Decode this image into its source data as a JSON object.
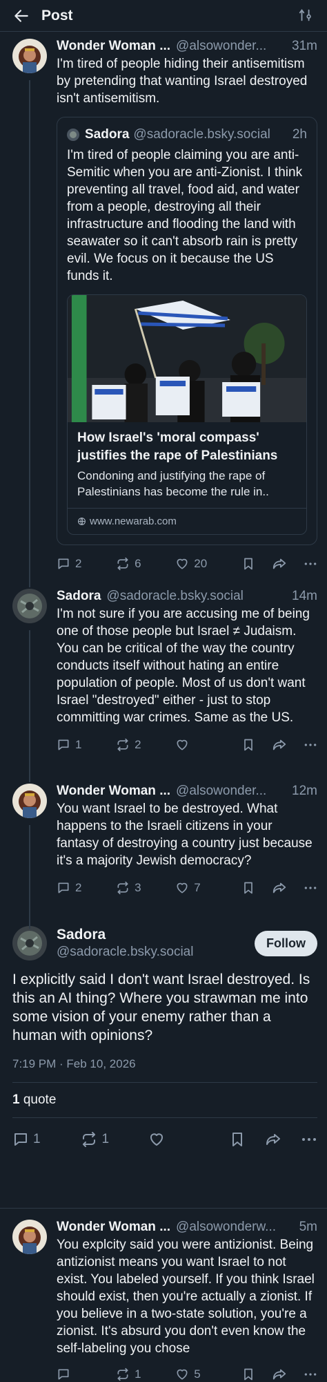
{
  "header": {
    "title": "Post"
  },
  "posts": [
    {
      "name": "Wonder Woman ...",
      "handle": "@alsowonder...",
      "time": "31m",
      "text": "I'm tired of people hiding their antisemitism by pretending that wanting Israel destroyed isn't antisemitism.",
      "quote": {
        "name": "Sadora",
        "handle": "@sadoracle.bsky.social",
        "time": "2h",
        "text": "I'm tired of people claiming you are anti-Semitic when you are anti-Zionist. I think preventing all travel, food aid, and water from a people, destroying all their infrastructure and flooding the land with seawater so it can't absorb rain is pretty evil. We focus on it because the US funds it.",
        "card": {
          "title": "How Israel's 'moral compass' justifies the rape of Palestinians",
          "description": "Condoning and justifying the rape of Palestinians has become the rule in..",
          "domain": "www.newarab.com"
        }
      },
      "replies": "2",
      "reposts": "6",
      "likes": "20"
    },
    {
      "name": "Sadora",
      "handle": "@sadoracle.bsky.social",
      "time": "14m",
      "text": "I'm not sure if you are accusing me of being one of those people but Israel ≠ Judaism. You can be critical of the way the country conducts itself without hating an entire population of people. Most of us don't want Israel \"destroyed\" either - just to stop committing war crimes. Same as the US.",
      "replies": "1",
      "reposts": "2",
      "likes": ""
    },
    {
      "name": "Wonder Woman ...",
      "handle": "@alsowonder...",
      "time": "12m",
      "text": "You want Israel to be destroyed. What happens to the Israeli citizens in your fantasy of destroying a country just because it's a majority Jewish democracy?",
      "replies": "2",
      "reposts": "3",
      "likes": "7"
    }
  ],
  "focus": {
    "name": "Sadora",
    "handle": "@sadoracle.bsky.social",
    "follow_label": "Follow",
    "text": "I explicitly said I don't want Israel destroyed. Is this an AI thing? Where you strawman me into some vision of your enemy rather than a human with opinions?",
    "date": "7:19 PM · Feb 10, 2026",
    "quote_count": "1",
    "quote_label": "quote",
    "replies": "1",
    "reposts": "1"
  },
  "last_post": {
    "name": "Wonder Woman ...",
    "handle": "@alsowonderw...",
    "time": "5m",
    "text": "You explcity said you were antizionist. Being antizionist means you want Israel to not exist. You labeled yourself. If you think Israel should exist, then you're actually a zionist. If you believe in a two-state solution, you're a zionist. It's absurd you don't even know the self-labeling you chose",
    "replies": "",
    "reposts": "1",
    "likes": "5"
  },
  "colors": {
    "background": "#161e27",
    "muted": "#8c9aab",
    "border": "#2e3a47"
  }
}
